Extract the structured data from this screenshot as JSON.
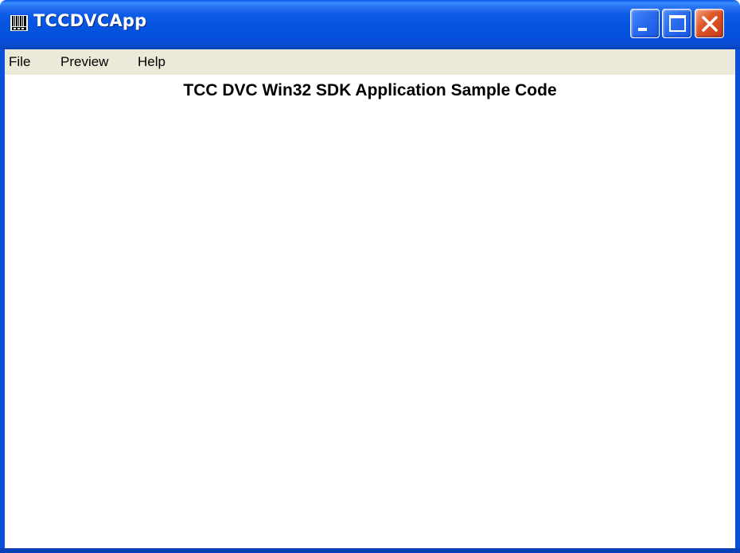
{
  "window": {
    "title": "TCCDVCApp"
  },
  "title_bar_buttons": {
    "minimize": "minimize-icon",
    "maximize": "maximize-icon",
    "close": "close-icon"
  },
  "menu": {
    "items": [
      {
        "label": "File"
      },
      {
        "label": "Preview"
      },
      {
        "label": "Help"
      }
    ]
  },
  "content": {
    "heading": "TCC DVC Win32 SDK Application Sample Code"
  },
  "colors": {
    "title_bar": "#0553df",
    "menu_bar": "#ece9d8",
    "close_button": "#e0582a",
    "client": "#ffffff"
  }
}
